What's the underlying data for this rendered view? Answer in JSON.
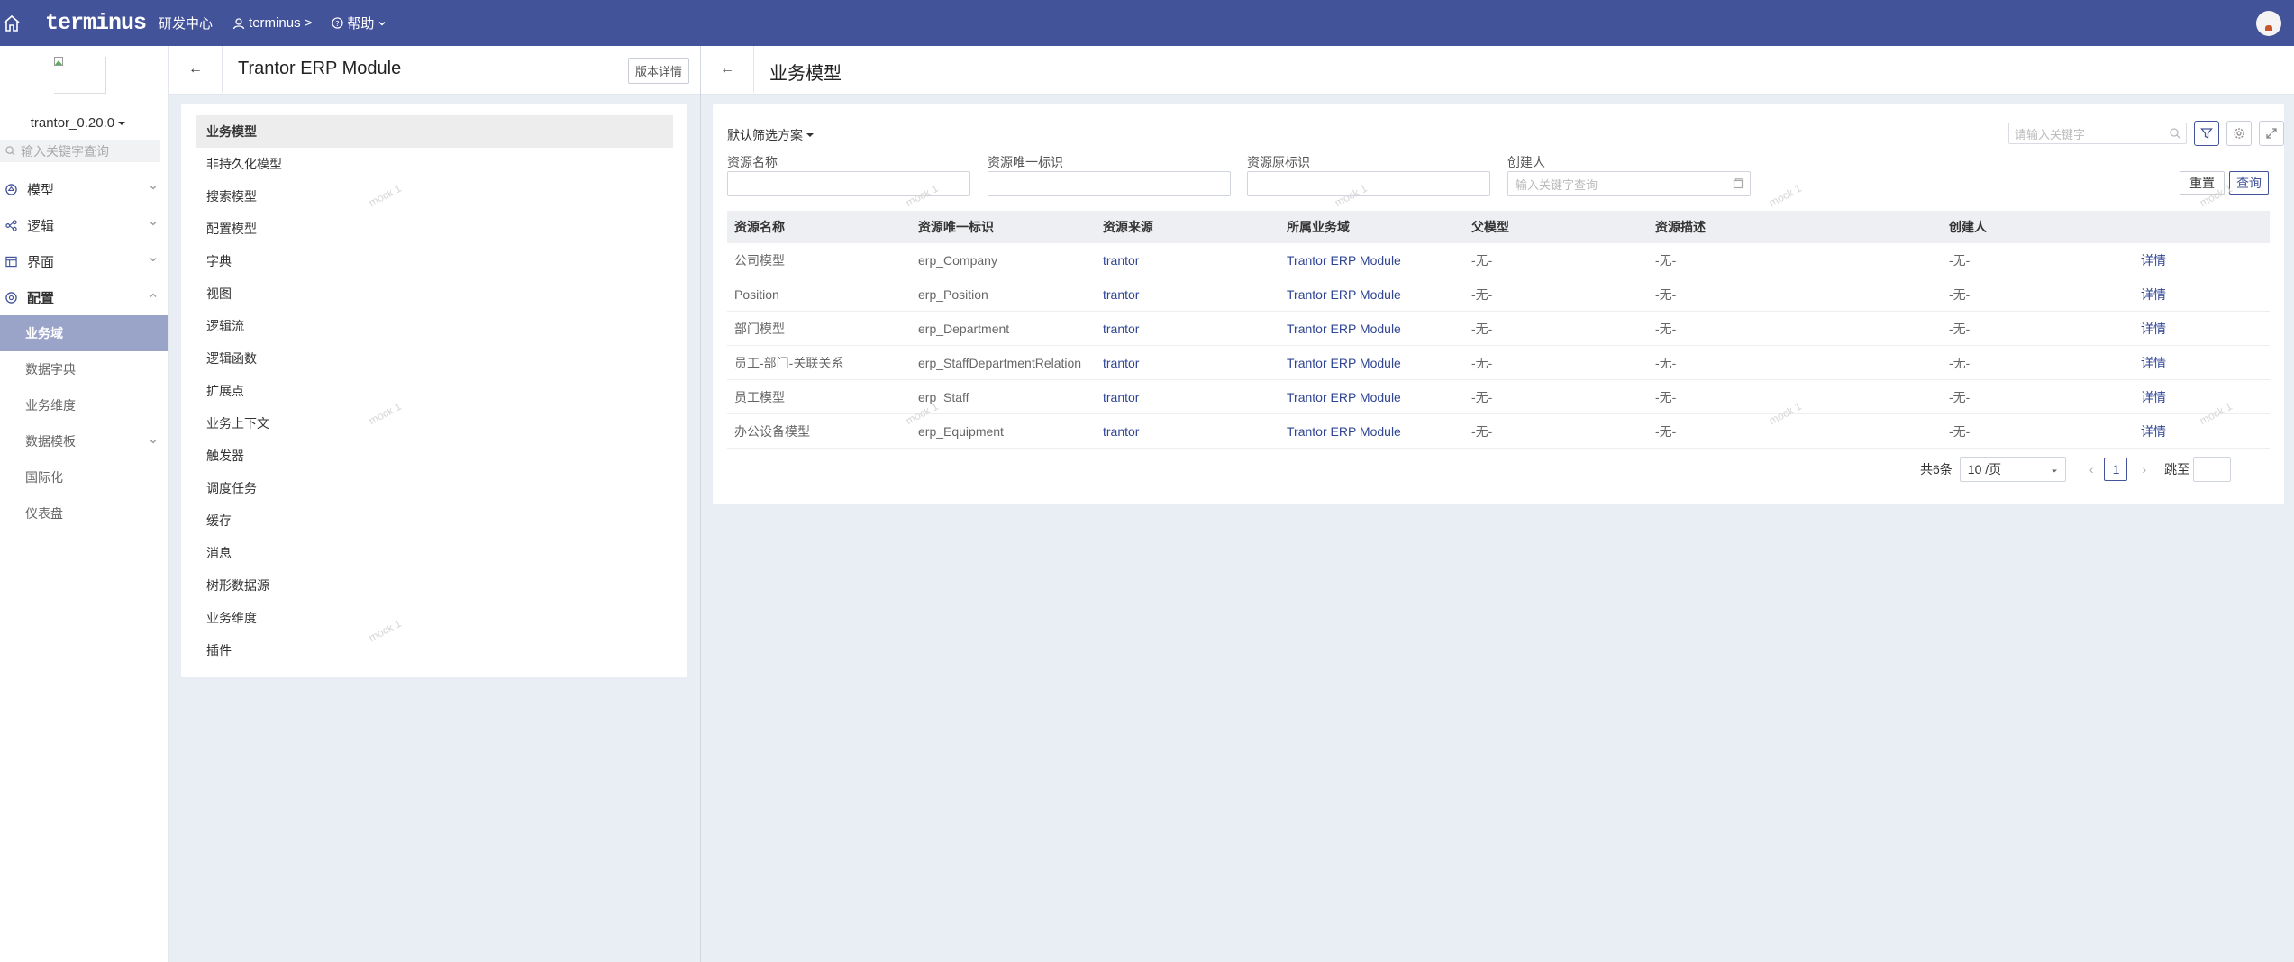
{
  "topbar": {
    "brand": "terminus",
    "center_label": "研发中心",
    "user_label": "terminus",
    "user_chevron": ">",
    "help_label": "帮助"
  },
  "sidebar": {
    "version": "trantor_0.20.0",
    "search_placeholder": "输入关键字查询",
    "groups": [
      {
        "label": "模型",
        "icon": "model-icon"
      },
      {
        "label": "逻辑",
        "icon": "logic-icon"
      },
      {
        "label": "界面",
        "icon": "ui-icon"
      },
      {
        "label": "配置",
        "icon": "config-icon"
      }
    ],
    "sub_items": [
      {
        "label": "业务域",
        "active": true
      },
      {
        "label": "数据字典"
      },
      {
        "label": "业务维度"
      },
      {
        "label": "数据模板"
      },
      {
        "label": "国际化"
      },
      {
        "label": "仪表盘"
      }
    ]
  },
  "middle": {
    "back": "←",
    "title": "Trantor ERP Module",
    "version_button": "版本详情",
    "items": [
      "业务模型",
      "非持久化模型",
      "搜索模型",
      "配置模型",
      "字典",
      "视图",
      "逻辑流",
      "逻辑函数",
      "扩展点",
      "业务上下文",
      "触发器",
      "调度任务",
      "缓存",
      "消息",
      "树形数据源",
      "业务维度",
      "插件"
    ]
  },
  "right": {
    "back": "←",
    "title": "业务模型",
    "filter_scheme": "默认筛选方案",
    "keyword_placeholder": "请输入关键字",
    "filters": [
      {
        "label": "资源名称",
        "placeholder": ""
      },
      {
        "label": "资源唯一标识",
        "placeholder": ""
      },
      {
        "label": "资源原标识",
        "placeholder": ""
      },
      {
        "label": "创建人",
        "placeholder": "输入关键字查询"
      }
    ],
    "reset_button": "重置",
    "query_button": "查询",
    "table": {
      "columns": [
        "资源名称",
        "资源唯一标识",
        "资源来源",
        "所属业务域",
        "父模型",
        "资源描述",
        "创建人",
        ""
      ],
      "rows": [
        [
          "公司模型",
          "erp_Company",
          "trantor",
          "Trantor ERP Module",
          "-无-",
          "-无-",
          "-无-",
          "详情"
        ],
        [
          "Position",
          "erp_Position",
          "trantor",
          "Trantor ERP Module",
          "-无-",
          "-无-",
          "-无-",
          "详情"
        ],
        [
          "部门模型",
          "erp_Department",
          "trantor",
          "Trantor ERP Module",
          "-无-",
          "-无-",
          "-无-",
          "详情"
        ],
        [
          "员工-部门-关联关系",
          "erp_StaffDepartmentRelation",
          "trantor",
          "Trantor ERP Module",
          "-无-",
          "-无-",
          "-无-",
          "详情"
        ],
        [
          "员工模型",
          "erp_Staff",
          "trantor",
          "Trantor ERP Module",
          "-无-",
          "-无-",
          "-无-",
          "详情"
        ],
        [
          "办公设备模型",
          "erp_Equipment",
          "trantor",
          "Trantor ERP Module",
          "-无-",
          "-无-",
          "-无-",
          "详情"
        ]
      ]
    },
    "pagination": {
      "total": "共6条",
      "page_size": "10 /页",
      "prev": "‹",
      "current": "1",
      "next": "›",
      "jump_label": "跳至"
    }
  },
  "watermark": "mock 1",
  "colors": {
    "topbar": "#43539a",
    "link": "#2f4594",
    "active_sidebar": "#9aa3c8",
    "background": "#e9edf4"
  }
}
